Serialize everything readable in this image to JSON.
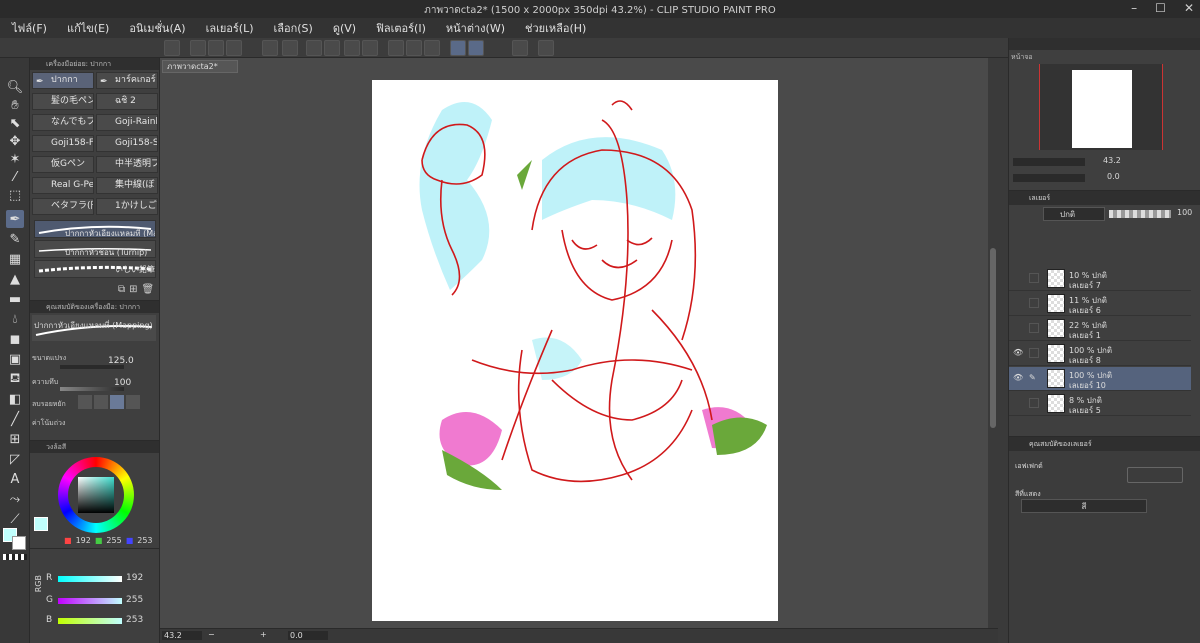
{
  "window": {
    "title": "ภาพวาดcta2* (1500 x 2000px 350dpi 43.2%)  - CLIP STUDIO PAINT PRO"
  },
  "menu": [
    "ไฟล์(F)",
    "แก้ไข(E)",
    "อนิเมชั่น(A)",
    "เลเยอร์(L)",
    "เลือก(S)",
    "ดู(V)",
    "ฟิลเตอร์(I)",
    "หน้าต่าง(W)",
    "ช่วยเหลือ(H)"
  ],
  "subtool": {
    "header": "เครื่องมือย่อย: ปากกา",
    "tabs": [
      "ปากกา",
      "มาร์คเกอร์"
    ],
    "brushes": [
      "髪の毛ペン",
      "ฉชิ 2",
      "なんでもブラ",
      "Goji-Rainb",
      "Goji158-Fo",
      "Goji158-Sh",
      "仮Gペン",
      "中半透明ブ",
      "Real G-Pe",
      "集中線(ぼ",
      "ベタフラ(円",
      "1かけしごむ"
    ],
    "strokes": [
      "ปากกาหัวเอียงแหลมที่ (Mapping)",
      "ปากกาหัวช้อน (Turnip)",
      "いしい鉛筆"
    ]
  },
  "toolprop": {
    "header": "คุณสมบัติของเครื่องมือ: ปากกา",
    "brushname": "ปากกาหัวเอียงแหลมที่ (Mapping)",
    "size_label": "ขนาดแปรง",
    "size_value": "125.0",
    "opacity_label": "ความทึบ",
    "opacity_value": "100",
    "antialias_label": "ลบรอยหยัก",
    "stabilization_label": "ค่าโน้มถ่วง"
  },
  "colorwheel": {
    "header": "วงล้อสี",
    "r": "192",
    "g": "255",
    "b": "253"
  },
  "colorslider": {
    "mode": "RGB",
    "r_label": "R",
    "g_label": "G",
    "b_label": "B",
    "r_value": "192",
    "g_value": "255",
    "b_value": "253"
  },
  "canvas": {
    "tab": "ภาพวาดcta2*",
    "zoom": "43.2",
    "rotation": "0.0"
  },
  "navigator": {
    "tab": "หน้าจอ",
    "zoom": "43.2",
    "rotation": "0.0"
  },
  "layers": {
    "tab": "เลเยอร์",
    "blend": "ปกติ",
    "opacity": "100",
    "items": [
      {
        "percent": "10 % ปกติ",
        "name": "เลเยอร์ 7"
      },
      {
        "percent": "11 % ปกติ",
        "name": "เลเยอร์ 6"
      },
      {
        "percent": "22 % ปกติ",
        "name": "เลเยอร์ 1"
      },
      {
        "percent": "100 % ปกติ",
        "name": "เลเยอร์ 8"
      },
      {
        "percent": "100 % ปกติ",
        "name": "เลเยอร์ 10"
      },
      {
        "percent": "8 % ปกติ",
        "name": "เลเยอร์ 5"
      }
    ]
  },
  "layerprop": {
    "header": "คุณสมบัติของเลเยอร์",
    "effect_label": "เอฟเฟกต์",
    "color_label": "สีที่แสดง",
    "color_value": "สี"
  }
}
